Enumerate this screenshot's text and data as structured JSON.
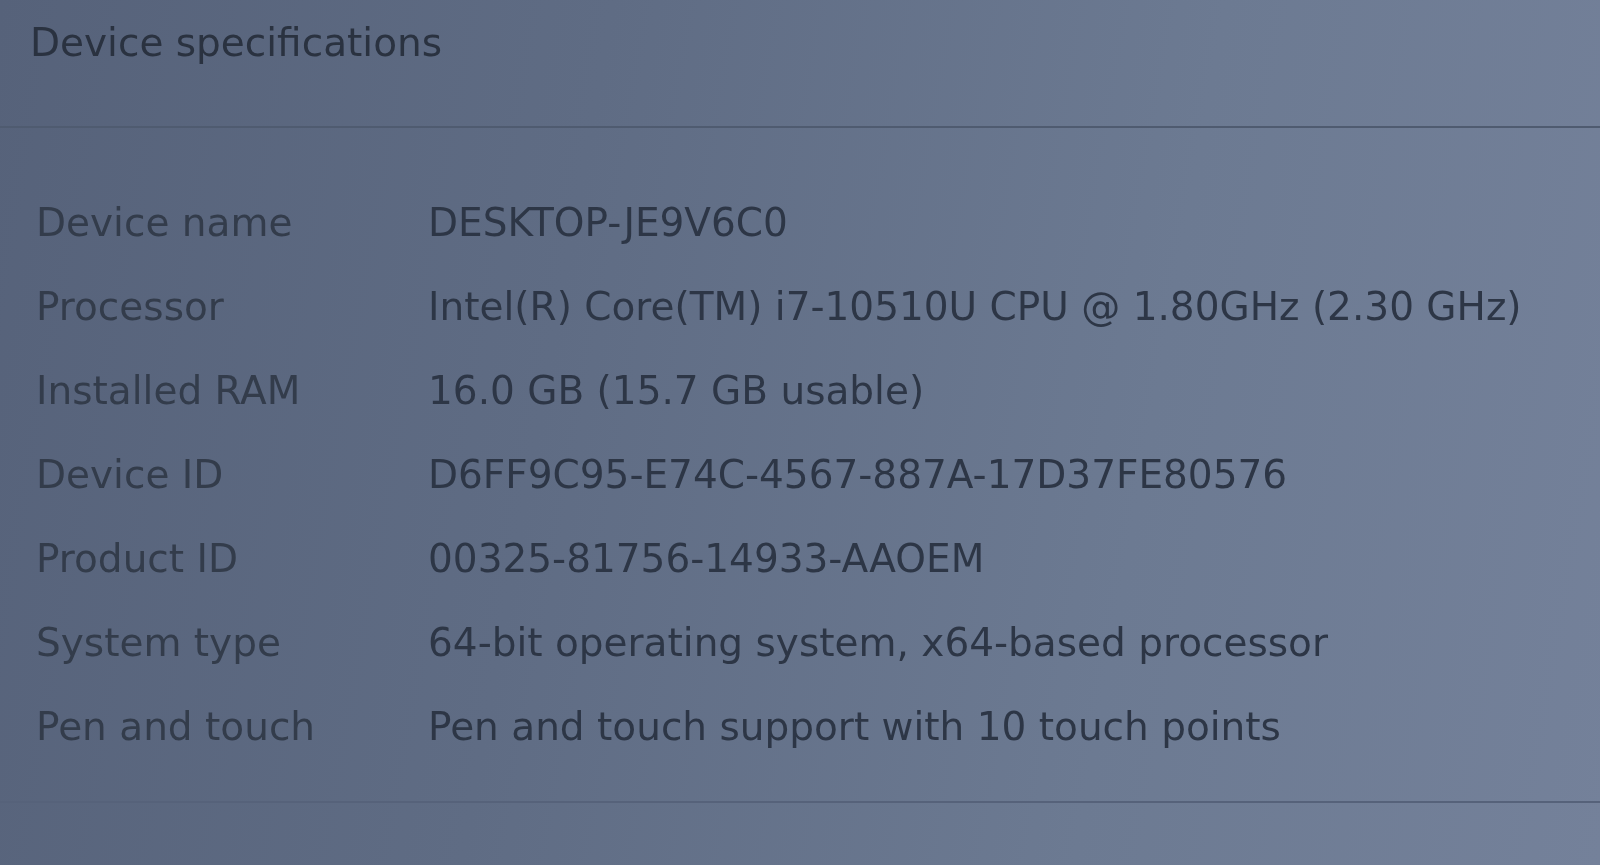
{
  "section": {
    "title": "Device specifications"
  },
  "specs": [
    {
      "label": "Device name",
      "value": "DESKTOP-JE9V6C0"
    },
    {
      "label": "Processor",
      "value": "Intel(R) Core(TM) i7-10510U CPU @ 1.80GHz (2.30 GHz)"
    },
    {
      "label": "Installed RAM",
      "value": "16.0 GB (15.7 GB usable)"
    },
    {
      "label": "Device ID",
      "value": "D6FF9C95-E74C-4567-887A-17D37FE80576"
    },
    {
      "label": "Product ID",
      "value": "00325-81756-14933-AAOEM"
    },
    {
      "label": "System type",
      "value": "64-bit operating system, x64-based processor"
    },
    {
      "label": "Pen and touch",
      "value": "Pen and touch support with 10 touch points"
    }
  ]
}
